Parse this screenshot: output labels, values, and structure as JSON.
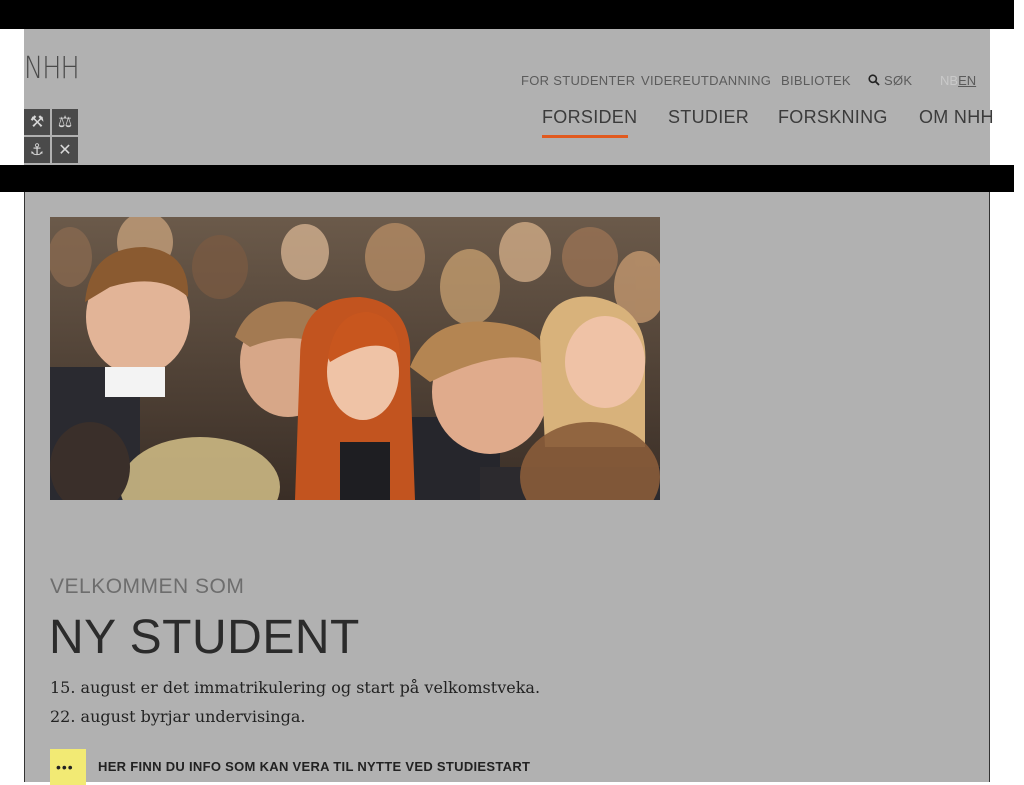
{
  "header": {
    "logo": "NHH",
    "crest_icons": [
      "hammers-icon",
      "scales-icon",
      "anchor-icon",
      "ship-icon"
    ],
    "utility": {
      "for_studenter": "FOR STUDENTER",
      "videreutdanning": "VIDEREUTDANNING",
      "bibliotek": "BIBLIOTEK",
      "sok": "SØK"
    },
    "lang": {
      "nb": "NB",
      "en": "EN"
    },
    "nav": {
      "forsiden": "FORSIDEN",
      "studier": "STUDIER",
      "forskning": "FORSKNING",
      "om_nhh": "OM NHH"
    },
    "active_color": "#e15a1f"
  },
  "main": {
    "kicker": "VELKOMMEN SOM",
    "title": "NY STUDENT",
    "line1": "15. august er det immatrikulering og start på velkomstveka.",
    "line2": "22. august byrjar undervisinga.",
    "info": "HER FINN DU INFO SOM KAN VERA TIL NYTTE VED STUDIESTART",
    "info_icon_color": "#f2ea74"
  }
}
